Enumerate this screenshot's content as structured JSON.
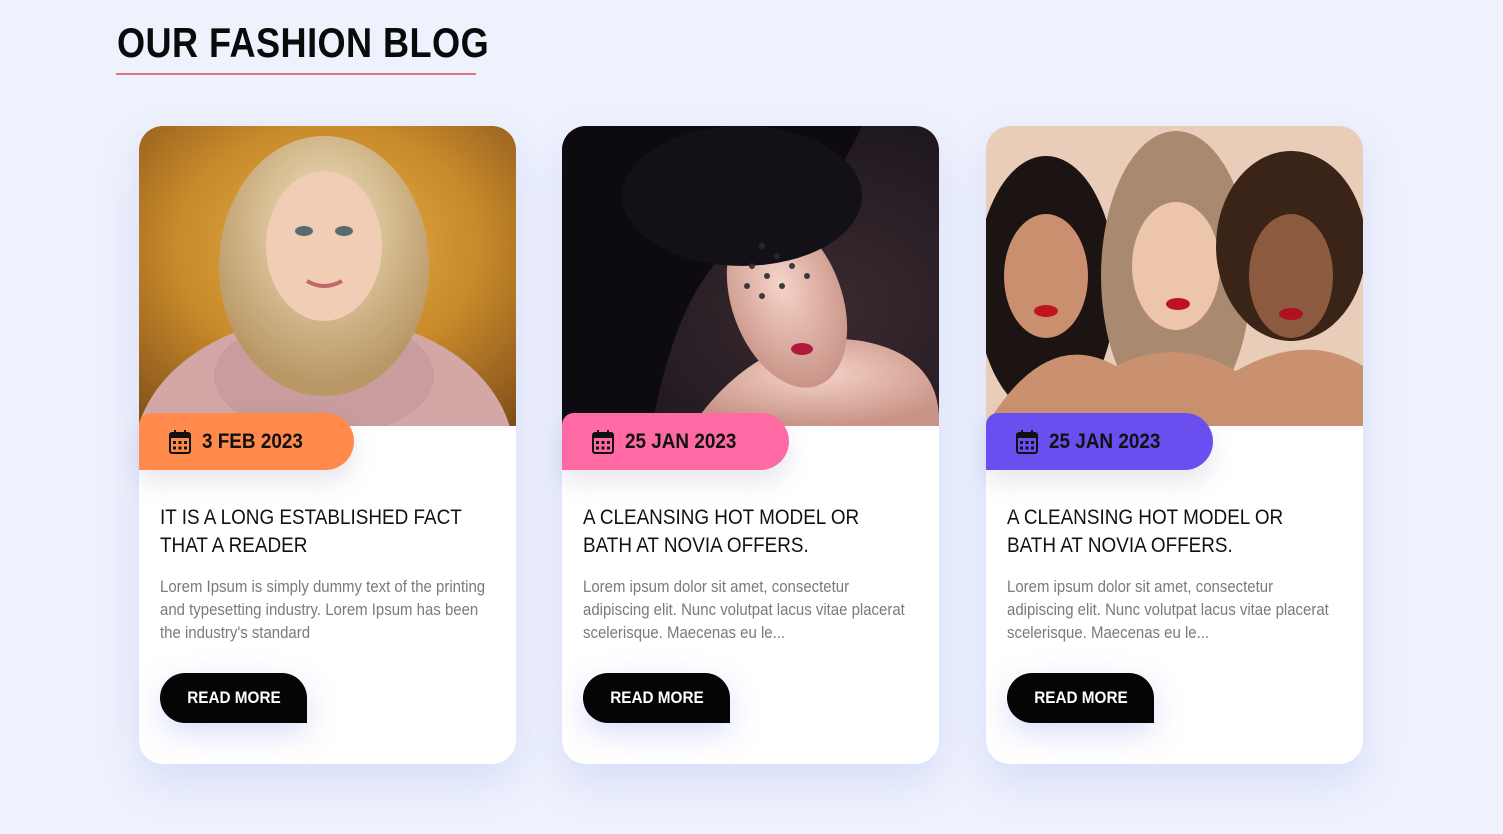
{
  "header": {
    "title": "OUR FASHION BLOG",
    "underline_color": "#e8717f"
  },
  "posts": [
    {
      "date": "3 FEB 2023",
      "badge_color": "#ff8a4c",
      "title": "IT IS A LONG ESTABLISHED FACT THAT A READER",
      "excerpt": "Lorem Ipsum is simply dummy text of the printing and typesetting industry. Lorem Ipsum has been the industry's standard",
      "button_label": "READ MORE",
      "icon": "calendar-icon"
    },
    {
      "date": "25 JAN 2023",
      "badge_color": "#ff6aa5",
      "title": "A CLEANSING HOT MODEL OR BATH AT NOVIA OFFERS.",
      "excerpt": "Lorem ipsum dolor sit amet, consectetur adipiscing elit. Nunc volutpat lacus vitae placerat scelerisque. Maecenas eu le...",
      "button_label": "READ MORE",
      "icon": "calendar-icon"
    },
    {
      "date": "25 JAN 2023",
      "badge_color": "#6b4ef0",
      "title": "A CLEANSING HOT MODEL OR BATH AT NOVIA OFFERS.",
      "excerpt": "Lorem ipsum dolor sit amet, consectetur adipiscing elit. Nunc volutpat lacus vitae placerat scelerisque. Maecenas eu le...",
      "button_label": "READ MORE",
      "icon": "calendar-icon"
    }
  ]
}
